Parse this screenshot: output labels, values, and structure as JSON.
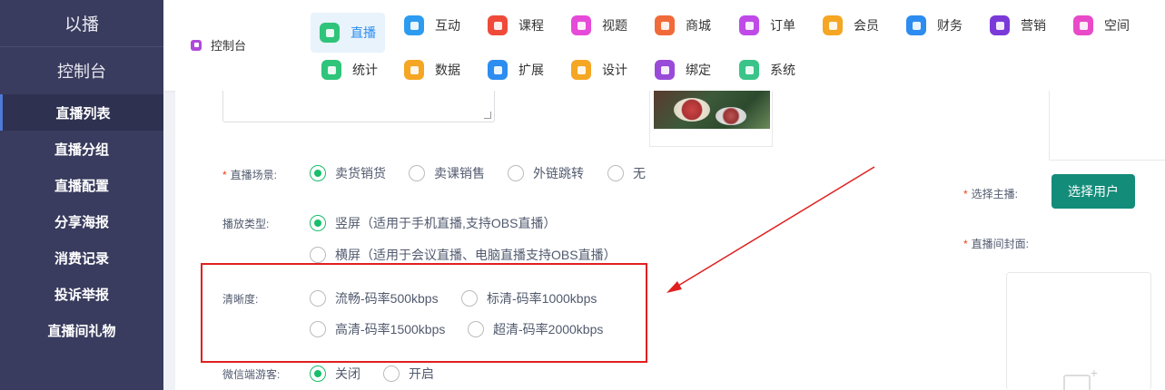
{
  "sidebar": {
    "brand": "以播",
    "console": "控制台",
    "items": [
      {
        "label": "直播列表"
      },
      {
        "label": "直播分组"
      },
      {
        "label": "直播配置"
      },
      {
        "label": "分享海报"
      },
      {
        "label": "消费记录"
      },
      {
        "label": "投诉举报"
      },
      {
        "label": "直播间礼物"
      }
    ]
  },
  "topnav": {
    "console": "控制台",
    "items": [
      {
        "label": "直播",
        "icon": "live-icon",
        "color": "#2ec47a"
      },
      {
        "label": "互动",
        "icon": "chat-icon",
        "color": "#2d9cf0"
      },
      {
        "label": "课程",
        "icon": "course-icon",
        "color": "#f04a3a"
      },
      {
        "label": "视题",
        "icon": "video-icon",
        "color": "#e64ad8"
      },
      {
        "label": "商城",
        "icon": "shop-icon",
        "color": "#f06a3a"
      },
      {
        "label": "订单",
        "icon": "order-icon",
        "color": "#c04ae8"
      },
      {
        "label": "会员",
        "icon": "member-icon",
        "color": "#f5a623"
      },
      {
        "label": "财务",
        "icon": "finance-icon",
        "color": "#2d8cf0"
      },
      {
        "label": "营销",
        "icon": "marketing-icon",
        "color": "#7a3ad8"
      },
      {
        "label": "空间",
        "icon": "space-icon",
        "color": "#e84ac8"
      },
      {
        "label": "统计",
        "icon": "stats-icon",
        "color": "#2ec47a"
      },
      {
        "label": "数据",
        "icon": "data-icon",
        "color": "#f5a623"
      },
      {
        "label": "扩展",
        "icon": "extend-icon",
        "color": "#2d8cf0"
      },
      {
        "label": "设计",
        "icon": "design-icon",
        "color": "#f5a623"
      },
      {
        "label": "绑定",
        "icon": "bind-icon",
        "color": "#9a4ad8"
      },
      {
        "label": "系统",
        "icon": "system-icon",
        "color": "#3ac48a"
      }
    ]
  },
  "form": {
    "scene": {
      "label": "直播场景:",
      "options": [
        "卖货销货",
        "卖课销售",
        "外链跳转",
        "无"
      ],
      "selected": "卖货销货"
    },
    "play_type": {
      "label": "播放类型:",
      "options": [
        "竖屏（适用于手机直播,支持OBS直播）",
        "横屏（适用于会议直播、电脑直播支持OBS直播）"
      ],
      "selected": "竖屏（适用于手机直播,支持OBS直播）"
    },
    "definition": {
      "label": "清晰度:",
      "options": [
        "流畅-码率500kbps",
        "标清-码率1000kbps",
        "高清-码率1500kbps",
        "超清-码率2000kbps"
      ]
    },
    "wechat_guest": {
      "label": "微信端游客:",
      "options": [
        "关闭",
        "开启"
      ],
      "selected": "关闭"
    },
    "anchor": {
      "label": "选择主播:",
      "button": "选择用户"
    },
    "cover": {
      "label": "直播间封面:"
    }
  },
  "colors": {
    "sidebar_bg": "#393c5e",
    "accent_green": "#19be6b",
    "button_teal": "#138c7a",
    "highlight_red": "#e02020",
    "nav_active_bg": "#e8f3fc",
    "nav_active_text": "#2d8cf0"
  }
}
